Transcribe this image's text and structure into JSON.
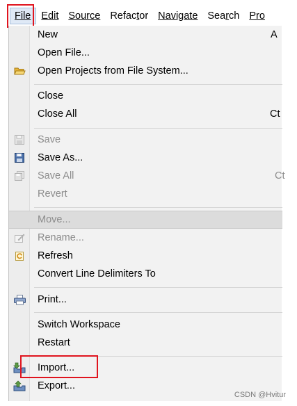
{
  "menubar": {
    "items": [
      "File",
      "Edit",
      "Source",
      "Refactor",
      "Navigate",
      "Search",
      "Pro"
    ],
    "mnemonic_index": [
      0,
      0,
      0,
      5,
      0,
      3,
      0
    ]
  },
  "menu": {
    "new": {
      "label": "New",
      "shortcut": "A"
    },
    "open_file": {
      "label": "Open File..."
    },
    "open_projects": {
      "label": "Open Projects from File System...",
      "icon": "folder-open-icon"
    },
    "close": {
      "label": "Close"
    },
    "close_all": {
      "label": "Close All",
      "shortcut": "Ct"
    },
    "save": {
      "label": "Save",
      "icon": "save-icon",
      "disabled": true
    },
    "save_as": {
      "label": "Save As...",
      "icon": "save-as-icon"
    },
    "save_all": {
      "label": "Save All",
      "shortcut": "Ct",
      "icon": "save-all-icon",
      "disabled": true
    },
    "revert": {
      "label": "Revert",
      "disabled": true
    },
    "move": {
      "label": "Move...",
      "disabled": true
    },
    "rename": {
      "label": "Rename...",
      "icon": "rename-icon",
      "disabled": true
    },
    "refresh": {
      "label": "Refresh",
      "icon": "refresh-icon"
    },
    "convert": {
      "label": "Convert Line Delimiters To"
    },
    "print": {
      "label": "Print...",
      "icon": "print-icon"
    },
    "switch_workspace": {
      "label": "Switch Workspace"
    },
    "restart": {
      "label": "Restart"
    },
    "import": {
      "label": "Import...",
      "icon": "import-icon"
    },
    "export": {
      "label": "Export...",
      "icon": "export-icon"
    }
  },
  "watermark": "CSDN @Hvitur",
  "colors": {
    "highlight_box": "#e0141e",
    "menu_bg": "#f2f2f2"
  }
}
